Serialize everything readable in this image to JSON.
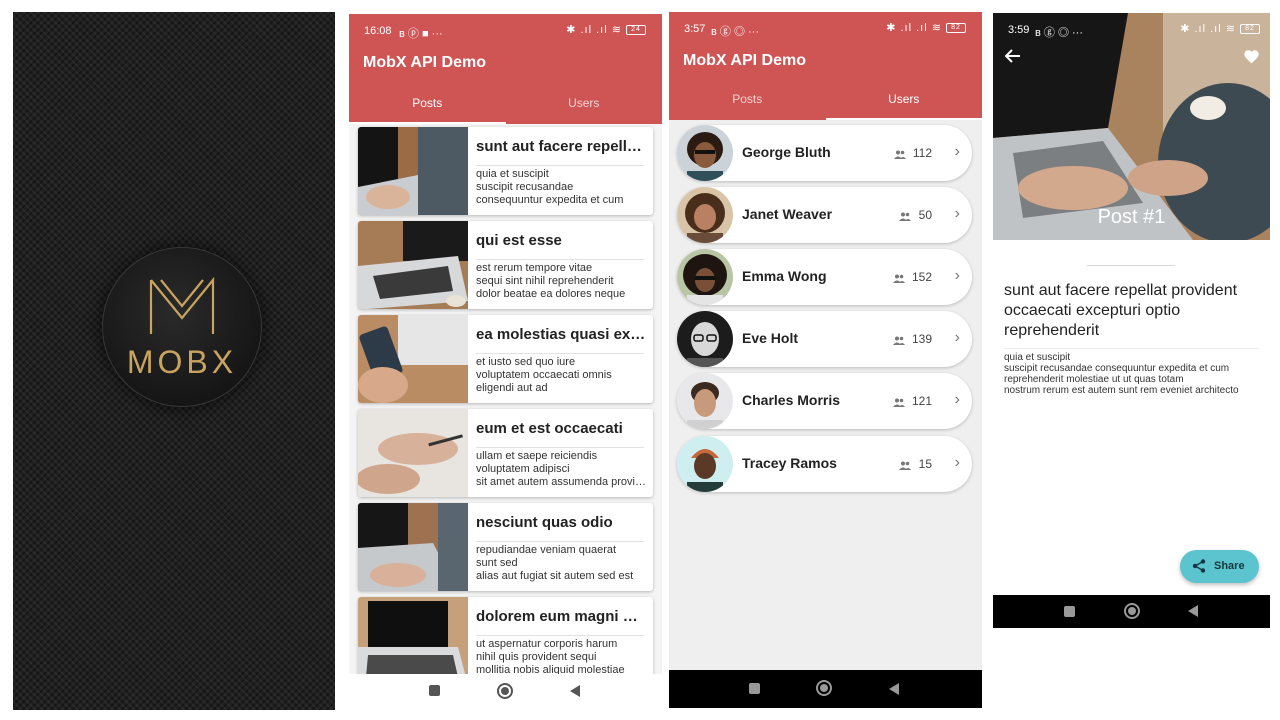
{
  "splash": {
    "logo_text": "MOBX"
  },
  "posts_screen": {
    "status": {
      "time": "16:08",
      "left_icons": "ʙ ⓟ ■ ···",
      "right_icons": "✱ .ıl .ıl ≋",
      "battery": "24"
    },
    "title": "MobX API Demo",
    "tabs": [
      {
        "label": "Posts",
        "active": true
      },
      {
        "label": "Users",
        "active": false
      }
    ],
    "posts": [
      {
        "title": "sunt aut facere repellat provident occaecati excepturi optio reprehenderit",
        "body": [
          "quia et suscipit",
          "suscipit recusandae",
          "consequuntur expedita et cum"
        ]
      },
      {
        "title": "qui est esse",
        "body": [
          "est rerum tempore vitae",
          "sequi sint nihil reprehenderit",
          "dolor beatae ea dolores neque"
        ]
      },
      {
        "title": "ea molestias quasi exercitationem",
        "body": [
          "et iusto sed quo iure",
          "voluptatem occaecati omnis",
          "eligendi aut ad"
        ]
      },
      {
        "title": "eum et est occaecati",
        "body": [
          "ullam et saepe reiciendis",
          "voluptatem adipisci",
          "sit amet autem assumenda provident"
        ]
      },
      {
        "title": "nesciunt quas odio",
        "body": [
          "repudiandae veniam quaerat",
          "sunt sed",
          "alias aut fugiat sit autem sed est"
        ]
      },
      {
        "title": "dolorem eum magni eos aperiam",
        "body": [
          "ut aspernatur corporis harum",
          "nihil quis provident sequi",
          "mollitia nobis aliquid molestiae"
        ]
      }
    ]
  },
  "users_screen": {
    "status": {
      "time": "3:57",
      "left_icons": "ʙ ⓖ ◎ ···",
      "right_icons": "✱ .ıl .ıl ≋",
      "battery": "82"
    },
    "title": "MobX API Demo",
    "tabs": [
      {
        "label": "Posts",
        "active": false
      },
      {
        "label": "Users",
        "active": true
      }
    ],
    "users": [
      {
        "name": "George Bluth",
        "count": "112",
        "avatar_color": "#6b4a33"
      },
      {
        "name": "Janet Weaver",
        "count": "50",
        "avatar_color": "#8a5b3c"
      },
      {
        "name": "Emma Wong",
        "count": "152",
        "avatar_color": "#3e2c24"
      },
      {
        "name": "Eve Holt",
        "count": "139",
        "avatar_color": "#7a7a7a"
      },
      {
        "name": "Charles Morris",
        "count": "121",
        "avatar_color": "#5a4536"
      },
      {
        "name": "Tracey Ramos",
        "count": "15",
        "avatar_color": "#c4673a"
      }
    ]
  },
  "detail_screen": {
    "status": {
      "time": "3:59",
      "left_icons": "ʙ ⓖ ◎ ···",
      "right_icons": "✱ .ıl .ıl ≋",
      "battery": "82"
    },
    "hero_caption": "Post #1",
    "title": "sunt aut facere repellat provident occaecati excepturi optio reprehenderit",
    "body": [
      "quia et suscipit",
      "suscipit recusandae consequuntur expedita et cum",
      "reprehenderit molestiae ut ut quas totam",
      "nostrum rerum est autem sunt rem eveniet architecto"
    ],
    "share_label": "Share",
    "liked": true
  },
  "colors": {
    "app_bar": "#cf5555",
    "share_button": "#5cc4cf",
    "logo_gold": "#c9a45f"
  }
}
